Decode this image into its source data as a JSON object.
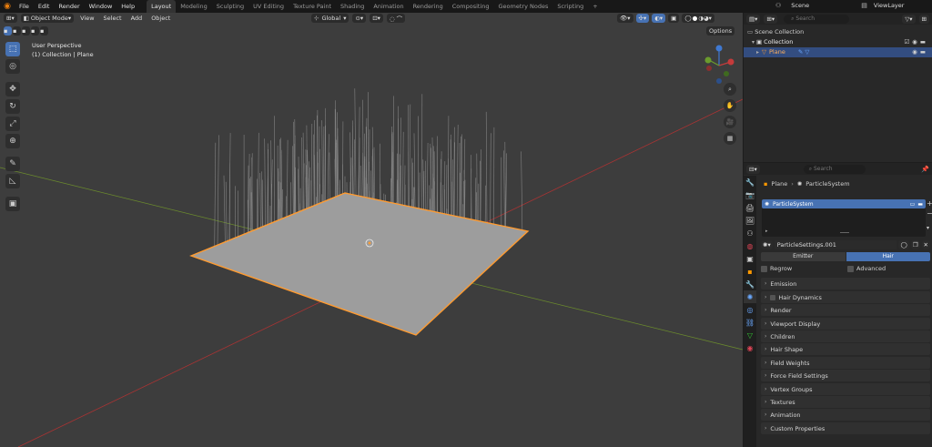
{
  "menu": {
    "file": "File",
    "edit": "Edit",
    "render": "Render",
    "window": "Window",
    "help": "Help"
  },
  "workspaces": [
    "Layout",
    "Modeling",
    "Sculpting",
    "UV Editing",
    "Texture Paint",
    "Shading",
    "Animation",
    "Rendering",
    "Compositing",
    "Geometry Nodes",
    "Scripting"
  ],
  "scene": {
    "name": "Scene",
    "view_layer": "ViewLayer"
  },
  "viewport": {
    "mode": "Object Mode",
    "menus": [
      "View",
      "Select",
      "Add",
      "Object"
    ],
    "transform_orientation": "Global",
    "options": "Options",
    "overlay_line1": "User Perspective",
    "overlay_line2": "(1) Collection | Plane"
  },
  "outliner": {
    "search_placeholder": "Search",
    "scene_collection": "Scene Collection",
    "collection": "Collection",
    "object": "Plane"
  },
  "properties": {
    "search_placeholder": "Search",
    "breadcrumb_object": "Plane",
    "breadcrumb_system": "ParticleSystem",
    "list_item": "ParticleSystem",
    "settings_name": "ParticleSettings.001",
    "type_emitter": "Emitter",
    "type_hair": "Hair",
    "regrow": "Regrow",
    "advanced": "Advanced",
    "panels": [
      "Emission",
      "Hair Dynamics",
      "Render",
      "Viewport Display",
      "Children",
      "Hair Shape",
      "Field Weights",
      "Force Field Settings",
      "Vertex Groups",
      "Textures",
      "Animation",
      "Custom Properties"
    ]
  },
  "colors": {
    "accent": "#4772b3",
    "selection": "#ff9b30",
    "axis_x": "#c43b3b",
    "axis_y": "#6b9b2d",
    "axis_z": "#3f79d2"
  }
}
